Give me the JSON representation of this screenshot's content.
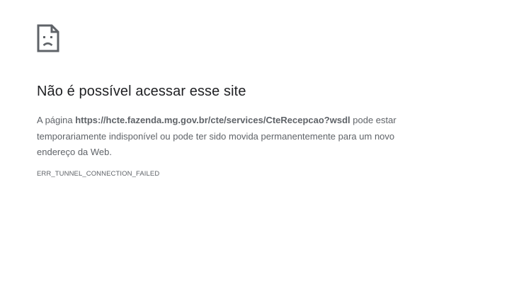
{
  "icon": {
    "name": "sad-page-icon",
    "color": "#5f6368"
  },
  "title": "Não é possível acessar esse site",
  "message": {
    "prefix": "A página ",
    "url": "https://hcte.fazenda.mg.gov.br/cte/services/CteRecepcao?wsdl",
    "suffix": " pode estar temporariamente indisponível ou pode ter sido movida permanentemente para um novo endereço da Web."
  },
  "error_code": "ERR_TUNNEL_CONNECTION_FAILED",
  "colors": {
    "title": "#202124",
    "text": "#5f6368",
    "background": "#ffffff"
  }
}
